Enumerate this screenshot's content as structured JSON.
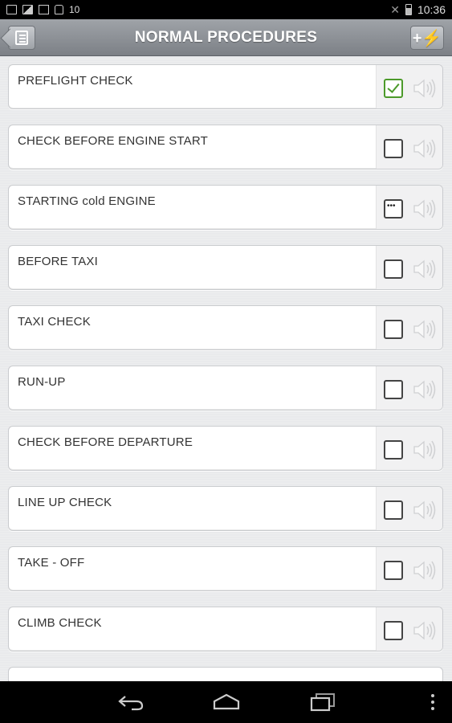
{
  "status_bar": {
    "notification_count": "10",
    "time": "10:36",
    "icons": [
      "window-icon",
      "image-icon",
      "mail-icon",
      "bag-icon",
      "silent-icon",
      "battery-icon"
    ]
  },
  "title_bar": {
    "title": "NORMAL PROCEDURES",
    "add_button_label": "+⚡"
  },
  "checklist": [
    {
      "label": "PREFLIGHT CHECK",
      "state": "checked"
    },
    {
      "label": "CHECK BEFORE ENGINE START",
      "state": "unchecked"
    },
    {
      "label": "STARTING cold ENGINE",
      "state": "in-progress"
    },
    {
      "label": "BEFORE TAXI",
      "state": "unchecked"
    },
    {
      "label": "TAXI CHECK",
      "state": "unchecked"
    },
    {
      "label": "RUN-UP",
      "state": "unchecked"
    },
    {
      "label": "CHECK BEFORE DEPARTURE",
      "state": "unchecked"
    },
    {
      "label": "LINE UP CHECK",
      "state": "unchecked"
    },
    {
      "label": "TAKE - OFF",
      "state": "unchecked"
    },
    {
      "label": "CLIMB CHECK",
      "state": "unchecked"
    }
  ],
  "colors": {
    "checked_accent": "#4c9a2a",
    "title_bar": "#8d9196"
  }
}
